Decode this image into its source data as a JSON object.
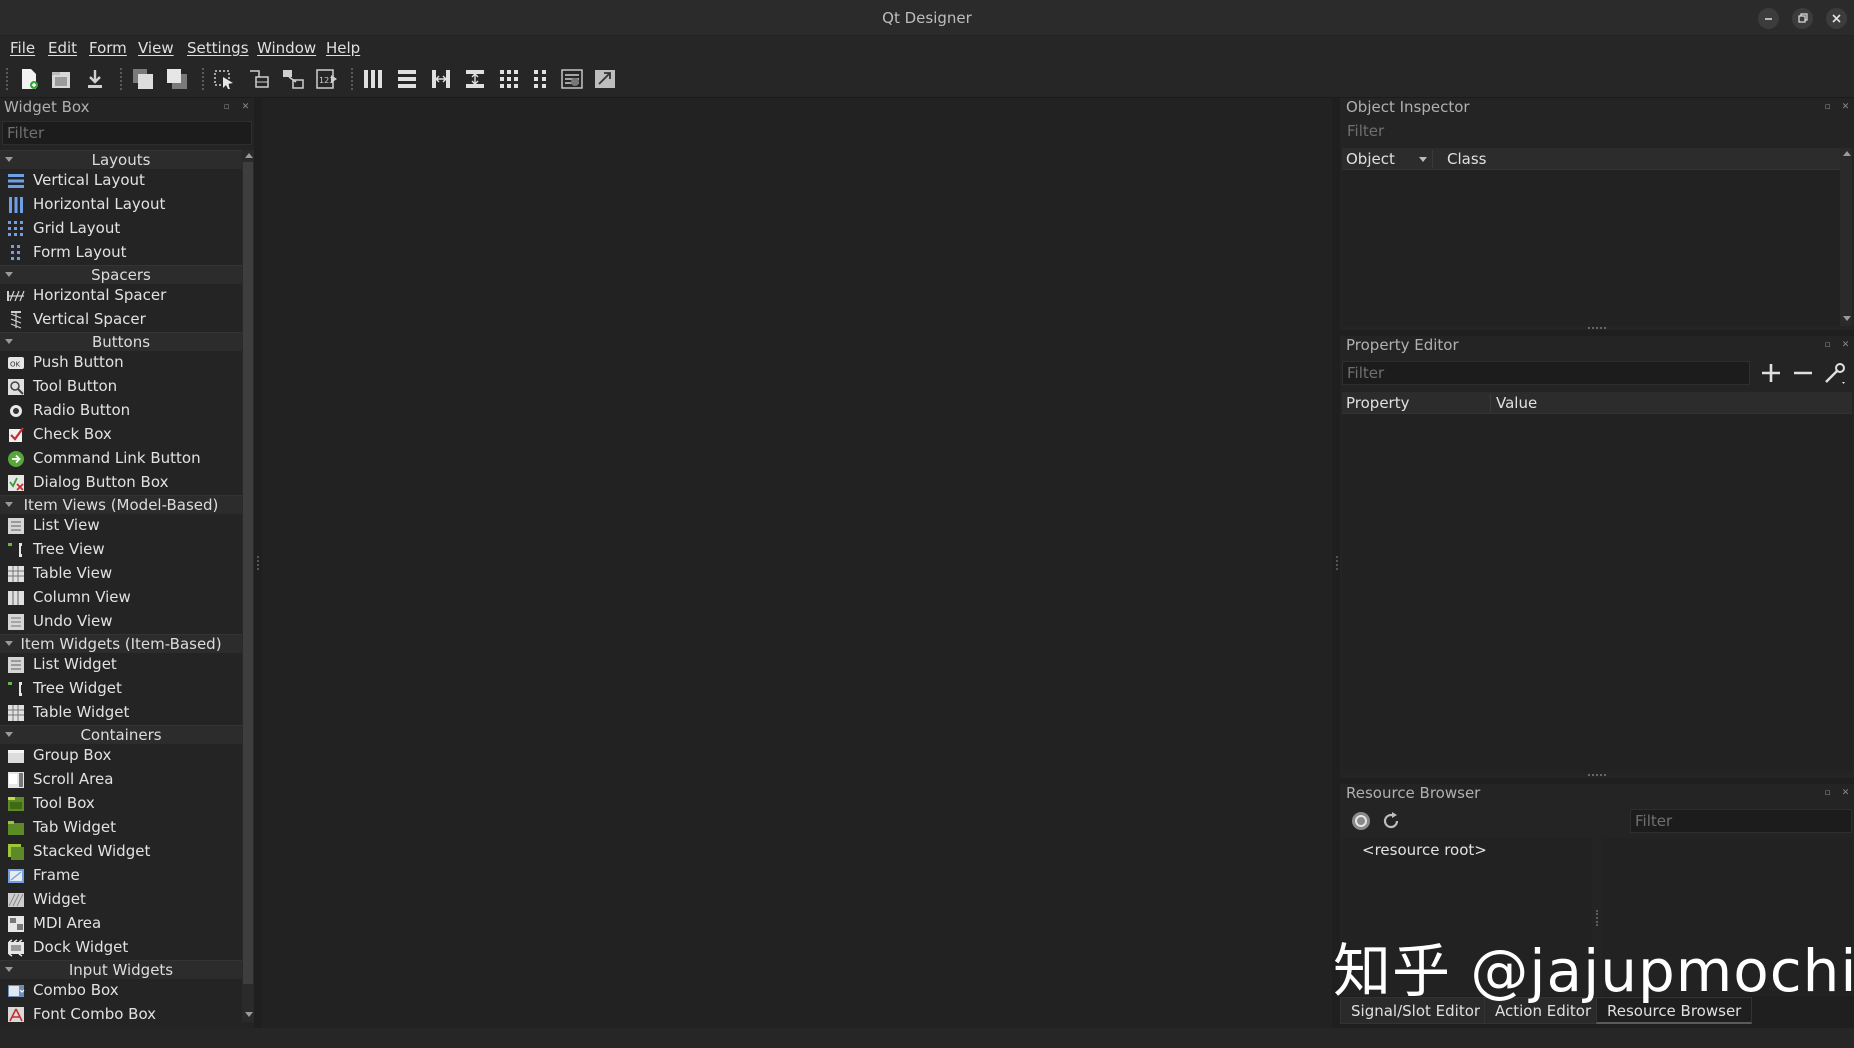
{
  "window": {
    "title": "Qt Designer"
  },
  "menubar": {
    "items": [
      "File",
      "Edit",
      "Form",
      "View",
      "Settings",
      "Window",
      "Help"
    ]
  },
  "toolbar": {
    "buttons": [
      "new-form",
      "open-form",
      "save-form",
      "send-to-back",
      "bring-to-front",
      "edit-widgets",
      "edit-signals-slots",
      "edit-buddies",
      "edit-tab-order",
      "lay-out-horizontally",
      "lay-out-vertically",
      "lay-out-horizontal-splitter",
      "lay-out-vertical-splitter",
      "lay-out-grid",
      "lay-out-form",
      "break-layout",
      "adjust-size"
    ]
  },
  "widget_box": {
    "title": "Widget Box",
    "filter_placeholder": "Filter",
    "categories": [
      {
        "name": "Layouts",
        "items": [
          {
            "label": "Vertical Layout",
            "icon": "vertical-layout-icon"
          },
          {
            "label": "Horizontal Layout",
            "icon": "horizontal-layout-icon"
          },
          {
            "label": "Grid Layout",
            "icon": "grid-layout-icon"
          },
          {
            "label": "Form Layout",
            "icon": "form-layout-icon"
          }
        ]
      },
      {
        "name": "Spacers",
        "items": [
          {
            "label": "Horizontal Spacer",
            "icon": "horizontal-spacer-icon"
          },
          {
            "label": "Vertical Spacer",
            "icon": "vertical-spacer-icon"
          }
        ]
      },
      {
        "name": "Buttons",
        "items": [
          {
            "label": "Push Button",
            "icon": "push-button-icon"
          },
          {
            "label": "Tool Button",
            "icon": "tool-button-icon"
          },
          {
            "label": "Radio Button",
            "icon": "radio-button-icon"
          },
          {
            "label": "Check Box",
            "icon": "check-box-icon"
          },
          {
            "label": "Command Link Button",
            "icon": "command-link-icon"
          },
          {
            "label": "Dialog Button Box",
            "icon": "dialog-button-box-icon"
          }
        ]
      },
      {
        "name": "Item Views (Model-Based)",
        "items": [
          {
            "label": "List View",
            "icon": "list-view-icon"
          },
          {
            "label": "Tree View",
            "icon": "tree-view-icon"
          },
          {
            "label": "Table View",
            "icon": "table-view-icon"
          },
          {
            "label": "Column View",
            "icon": "column-view-icon"
          },
          {
            "label": "Undo View",
            "icon": "undo-view-icon"
          }
        ]
      },
      {
        "name": "Item Widgets (Item-Based)",
        "items": [
          {
            "label": "List Widget",
            "icon": "list-widget-icon"
          },
          {
            "label": "Tree Widget",
            "icon": "tree-widget-icon"
          },
          {
            "label": "Table Widget",
            "icon": "table-widget-icon"
          }
        ]
      },
      {
        "name": "Containers",
        "items": [
          {
            "label": "Group Box",
            "icon": "group-box-icon"
          },
          {
            "label": "Scroll Area",
            "icon": "scroll-area-icon"
          },
          {
            "label": "Tool Box",
            "icon": "tool-box-icon"
          },
          {
            "label": "Tab Widget",
            "icon": "tab-widget-icon"
          },
          {
            "label": "Stacked Widget",
            "icon": "stacked-widget-icon"
          },
          {
            "label": "Frame",
            "icon": "frame-icon"
          },
          {
            "label": "Widget",
            "icon": "widget-icon"
          },
          {
            "label": "MDI Area",
            "icon": "mdi-area-icon"
          },
          {
            "label": "Dock Widget",
            "icon": "dock-widget-icon"
          }
        ]
      },
      {
        "name": "Input Widgets",
        "items": [
          {
            "label": "Combo Box",
            "icon": "combo-box-icon"
          },
          {
            "label": "Font Combo Box",
            "icon": "font-combo-box-icon"
          }
        ]
      }
    ]
  },
  "object_inspector": {
    "title": "Object Inspector",
    "filter_placeholder": "Filter",
    "columns": [
      "Object",
      "Class"
    ]
  },
  "property_editor": {
    "title": "Property Editor",
    "filter_placeholder": "Filter",
    "columns": [
      "Property",
      "Value"
    ]
  },
  "resource_browser": {
    "title": "Resource Browser",
    "filter_placeholder": "Filter",
    "root_item": "<resource root>"
  },
  "bottom_tabs": [
    {
      "label": "Signal/Slot Editor",
      "active": false
    },
    {
      "label": "Action Editor",
      "active": false
    },
    {
      "label": "Resource Browser",
      "active": true
    }
  ],
  "watermark": "知乎 @jajupmochi",
  "colors": {
    "background": "#1f1f1f",
    "panel": "#242424",
    "text": "#e0e0e0",
    "header": "#2c2c2c"
  }
}
